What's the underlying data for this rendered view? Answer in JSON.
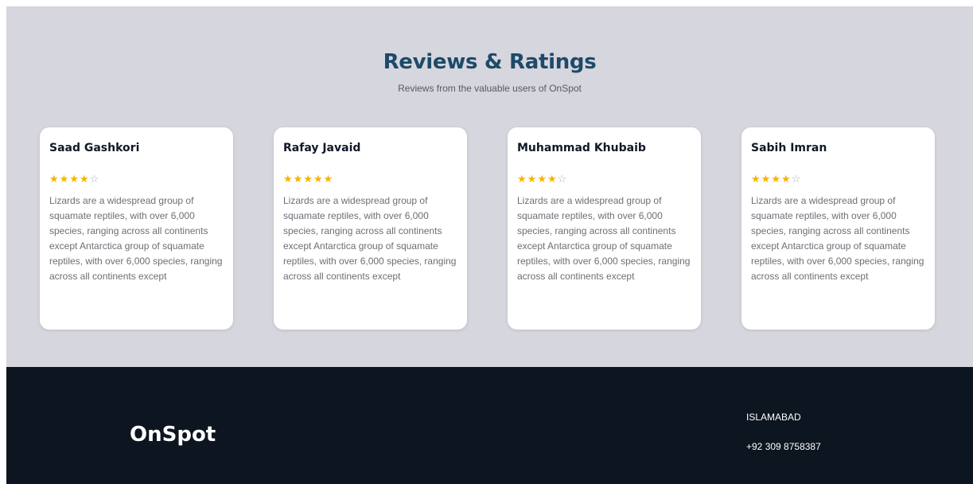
{
  "reviews": {
    "title": "Reviews & Ratings",
    "subtitle": "Reviews from the valuable users of OnSpot",
    "cards": [
      {
        "name": "Saad Gashkori",
        "rating": 4,
        "max_rating": 5,
        "text": "Lizards are a widespread group of squamate reptiles, with over 6,000 species, ranging across all continents except Antarctica group of squamate reptiles, with over 6,000 species, ranging across all continents except"
      },
      {
        "name": "Rafay Javaid",
        "rating": 5,
        "max_rating": 5,
        "text": "Lizards are a widespread group of squamate reptiles, with over 6,000 species, ranging across all continents except Antarctica group of squamate reptiles, with over 6,000 species, ranging across all continents except"
      },
      {
        "name": "Muhammad Khubaib",
        "rating": 4,
        "max_rating": 5,
        "text": "Lizards are a widespread group of squamate reptiles, with over 6,000 species, ranging across all continents except Antarctica group of squamate reptiles, with over 6,000 species, ranging across all continents except"
      },
      {
        "name": "Sabih Imran",
        "rating": 4,
        "max_rating": 5,
        "text": "Lizards are a widespread group of squamate reptiles, with over 6,000 species, ranging across all continents except Antarctica group of squamate reptiles, with over 6,000 species, ranging across all continents except"
      }
    ]
  },
  "footer": {
    "brand": "OnSpot",
    "city": "ISLAMABAD",
    "phone": "+92 309 8758387"
  },
  "colors": {
    "section_background": "#d6d6de",
    "title": "#1d4a68",
    "star": "#f5b301",
    "footer_background": "#0d1520"
  },
  "icons": {
    "filled_star": "star-filled-icon",
    "empty_star": "star-outline-icon"
  }
}
